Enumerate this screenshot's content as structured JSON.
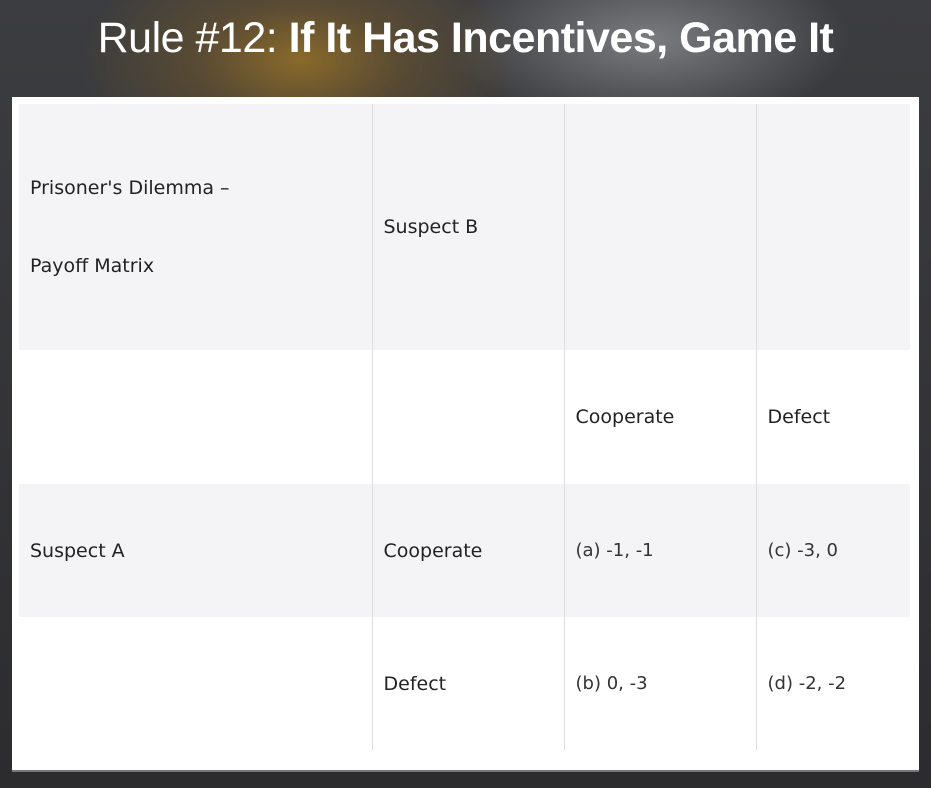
{
  "title": {
    "prefix": "Rule #12:",
    "main": "If It Has Incentives, Game It"
  },
  "table": {
    "caption_line1": "Prisoner's Dilemma –",
    "caption_line2": "Payoff Matrix",
    "player_b": "Suspect B",
    "player_a": "Suspect A",
    "col_headers": [
      "Cooperate",
      "Defect"
    ],
    "rows": [
      {
        "label": "Cooperate",
        "cells": [
          "(a) -1, -1",
          "(c) -3, 0"
        ]
      },
      {
        "label": "Defect",
        "cells": [
          "(b) 0, -3",
          "(d) -2, -2"
        ]
      }
    ]
  }
}
